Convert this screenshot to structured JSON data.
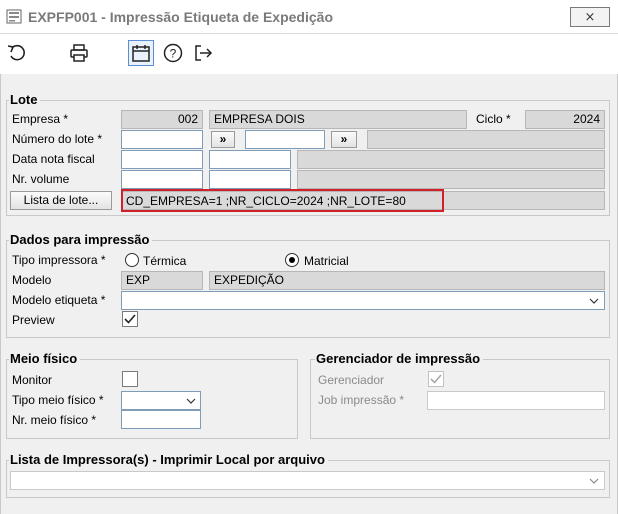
{
  "window": {
    "title": "EXPFP001 - Impressão Etiqueta de Expedição",
    "close_label": "⨯"
  },
  "toolbar": {
    "icons": [
      "undo-icon",
      "print-icon",
      "calendar-icon",
      "help-icon",
      "exit-icon"
    ],
    "undo_glyph": "⟲",
    "print_glyph": "⎙",
    "calendar_glyph": "📅",
    "help_glyph": "?",
    "exit_glyph": "[→"
  },
  "lote": {
    "title": "Lote",
    "empresa_label": "Empresa *",
    "empresa_code": "002",
    "empresa_name": "EMPRESA DOIS",
    "ciclo_label": "Ciclo *",
    "ciclo_value": "2024",
    "numero_lote_label": "Número do lote *",
    "numero_lote_value": "",
    "range_btn1": "»",
    "range_btn2": "»",
    "range_value": "",
    "data_nota_label": "Data nota fiscal",
    "data_nota_value": "",
    "nr_volume_label": "Nr. volume",
    "nr_volume_value": "",
    "lista_btn": "Lista de lote...",
    "lista_value": "CD_EMPRESA=1 ;NR_CICLO=2024 ;NR_LOTE=80"
  },
  "dados": {
    "title": "Dados para impressão",
    "tipo_label": "Tipo impressora *",
    "opt_termica": "Térmica",
    "opt_matricial": "Matricial",
    "selected": "Matricial",
    "modelo_label": "Modelo",
    "modelo_code": "EXP",
    "modelo_name": "EXPEDIÇÃO",
    "modelo_etiqueta_label": "Modelo etiqueta *",
    "modelo_etiqueta_value": "",
    "preview_label": "Preview",
    "preview_checked": true
  },
  "meio": {
    "title": "Meio físico",
    "monitor_label": "Monitor",
    "monitor_checked": false,
    "tipo_label": "Tipo meio físico *",
    "tipo_value": "",
    "nr_label": "Nr. meio físico *",
    "nr_value": ""
  },
  "gerenciador": {
    "title": "Gerenciador de impressão",
    "gerenciador_label": "Gerenciador",
    "gerenciador_checked": true,
    "job_label": "Job impressão *",
    "job_value": ""
  },
  "lista_impressoras": {
    "title": "Lista de Impressora(s) - Imprimir Local por arquivo",
    "value": ""
  }
}
